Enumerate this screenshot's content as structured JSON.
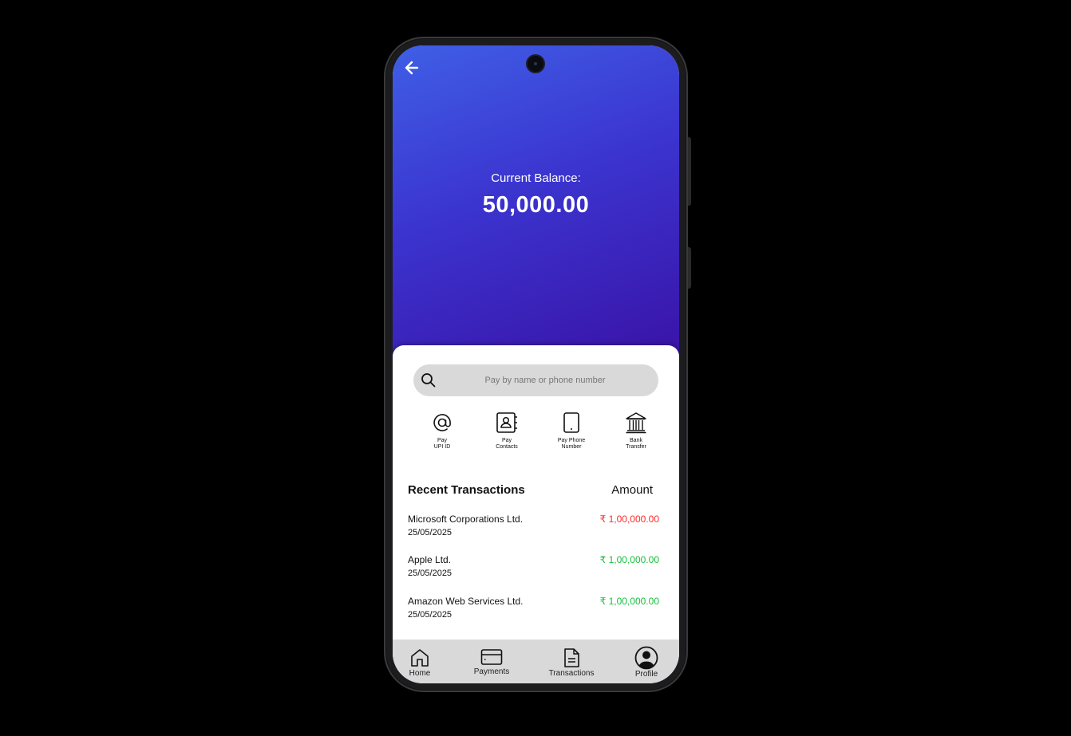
{
  "header": {
    "back_icon": "arrow-left-icon",
    "balance_label": "Current Balance:",
    "balance_value": "50,000.00"
  },
  "search": {
    "placeholder": "Pay by name or phone number",
    "icon": "search-icon"
  },
  "actions": [
    {
      "icon": "at-sign-icon",
      "line1": "Pay",
      "line2": "UPI ID"
    },
    {
      "icon": "contacts-book-icon",
      "line1": "Pay",
      "line2": "Contacts"
    },
    {
      "icon": "phone-device-icon",
      "line1": "Pay Phone",
      "line2": "Number"
    },
    {
      "icon": "bank-icon",
      "line1": "Bank",
      "line2": "Transfer"
    }
  ],
  "transactions": {
    "title": "Recent Transactions",
    "amount_header": "Amount",
    "items": [
      {
        "name": "Microsoft Corporations Ltd.",
        "date": "25/05/2025",
        "amount": "₹ 1,00,000.00",
        "color": "#ff2a2a"
      },
      {
        "name": "Apple Ltd.",
        "date": "25/05/2025",
        "amount": "₹ 1,00,000.00",
        "color": "#12c23a"
      },
      {
        "name": "Amazon Web Services Ltd.",
        "date": "25/05/2025",
        "amount": "₹ 1,00,000.00",
        "color": "#12c23a"
      }
    ]
  },
  "nav": [
    {
      "icon": "home-icon",
      "label": "Home"
    },
    {
      "icon": "card-icon",
      "label": "Payments"
    },
    {
      "icon": "document-icon",
      "label": "Transactions"
    },
    {
      "icon": "profile-icon",
      "label": "Profile"
    }
  ],
  "colors": {
    "accent_start": "#3f5fe6",
    "accent_end": "#3a12a6",
    "debit": "#ff2a2a",
    "credit": "#12c23a"
  }
}
